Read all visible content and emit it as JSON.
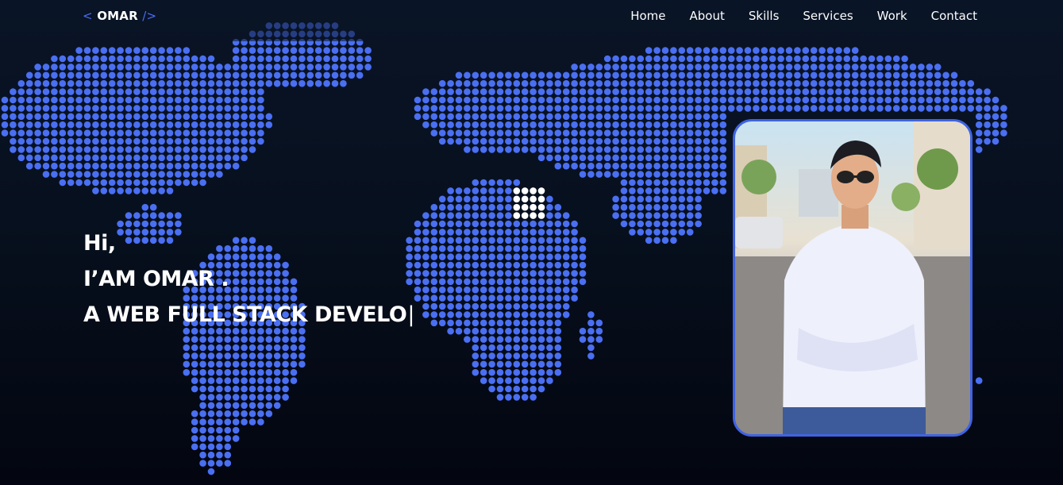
{
  "header": {
    "logo_open": "<",
    "logo_text": "OMAR",
    "logo_close": "/>"
  },
  "nav": {
    "items": [
      "Home",
      "About",
      "Skills",
      "Services",
      "Work",
      "Contact"
    ]
  },
  "hero": {
    "line1": "Hi,",
    "line2": "I’AM OMAR .",
    "line3": "A WEB FULL STACK DEVELO",
    "cursor": "|"
  },
  "colors": {
    "map_dot": "#4a6ff2",
    "map_highlight": "#ffffff",
    "accent": "#3f63e3",
    "background": "#07101e"
  },
  "photo": {
    "icon": "profile-photo"
  }
}
